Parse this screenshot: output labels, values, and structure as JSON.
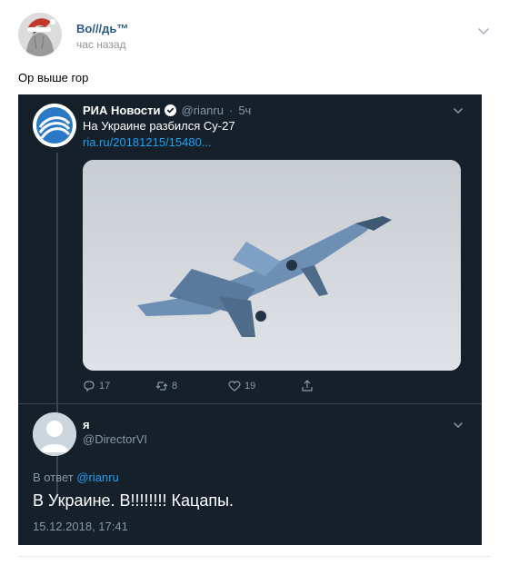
{
  "post": {
    "author": "Во///дь™",
    "time": "час назад",
    "text": "Ор выше гор",
    "avatar_icon": "santa-hat-avatar",
    "menu_icon": "chevron-down-icon"
  },
  "tweet": {
    "retweeted": {
      "name": "РИА Новости",
      "handle": "@rianru",
      "age": "5ч",
      "text": "На Украине разбился Су-27",
      "link": "ria.ru/20181215/15480...",
      "image_desc_icon": "fighter-jet-image",
      "actions": {
        "replies": "17",
        "retweets": "8",
        "likes": "19"
      }
    },
    "reply": {
      "name": "я",
      "handle": "@DirectorVI",
      "in_reply_prefix": "В ответ",
      "in_reply_to": "@rianru",
      "text": "В Украине. В!!!!!!!! Кацапы.",
      "date": "15.12.2018, 17:41"
    }
  },
  "colors": {
    "card_bg": "#15202b",
    "link": "#1da1f2",
    "muted": "#8899a6",
    "vk_link": "#2a5885"
  }
}
